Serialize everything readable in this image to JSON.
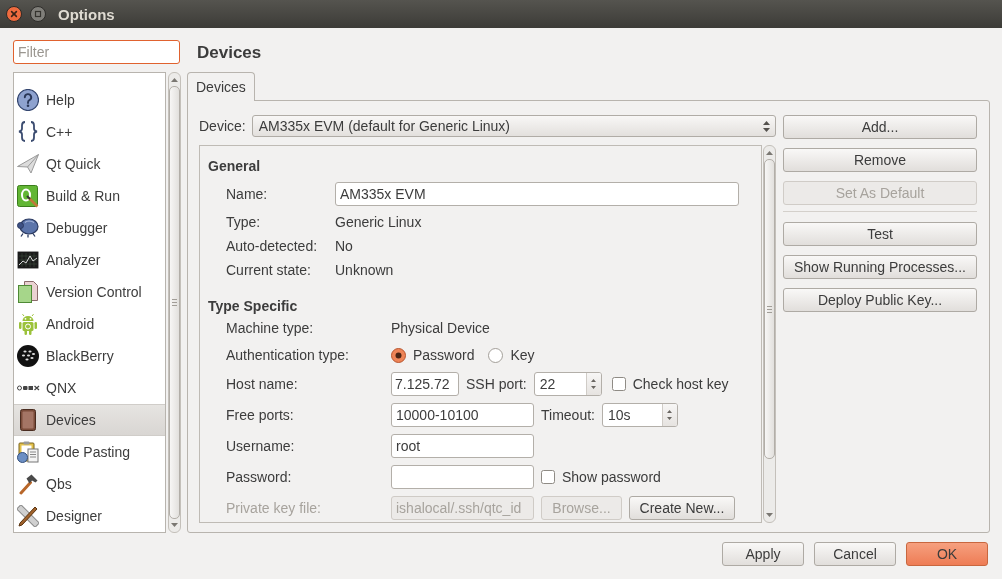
{
  "window": {
    "title": "Options"
  },
  "filter": {
    "placeholder": "Filter",
    "focused": true
  },
  "sidebar": {
    "items": [
      {
        "label": "Help",
        "selected": false
      },
      {
        "label": "C++",
        "selected": false
      },
      {
        "label": "Qt Quick",
        "selected": false
      },
      {
        "label": "Build & Run",
        "selected": false
      },
      {
        "label": "Debugger",
        "selected": false
      },
      {
        "label": "Analyzer",
        "selected": false
      },
      {
        "label": "Version Control",
        "selected": false
      },
      {
        "label": "Android",
        "selected": false
      },
      {
        "label": "BlackBerry",
        "selected": false
      },
      {
        "label": "QNX",
        "selected": false
      },
      {
        "label": "Devices",
        "selected": true
      },
      {
        "label": "Code Pasting",
        "selected": false
      },
      {
        "label": "Qbs",
        "selected": false
      },
      {
        "label": "Designer",
        "selected": false
      }
    ]
  },
  "page": {
    "title": "Devices",
    "tabs": [
      {
        "label": "Devices",
        "selected": true
      }
    ]
  },
  "device_selector": {
    "label": "Device:",
    "value": "AM335x EVM (default for Generic Linux)"
  },
  "general": {
    "title": "General",
    "rows": [
      {
        "label": "Name:",
        "kind": "field",
        "value": "AM335x EVM"
      },
      {
        "label": "Type:",
        "kind": "text",
        "value": "Generic Linux"
      },
      {
        "label": "Auto-detected:",
        "kind": "text",
        "value": "No"
      },
      {
        "label": "Current state:",
        "kind": "text",
        "value": "Unknown"
      }
    ]
  },
  "type_specific": {
    "title": "Type Specific",
    "rows": [
      {
        "label": "Machine type:",
        "disabled": false,
        "items": [
          {
            "kind": "text",
            "value": "Physical Device",
            "disabled": false
          }
        ]
      },
      {
        "label": "Authentication type:",
        "disabled": false,
        "items": [
          {
            "kind": "radio",
            "label": "Password",
            "selected": true,
            "disabled": false
          },
          {
            "kind": "radio",
            "label": "Key",
            "selected": false,
            "disabled": false
          }
        ]
      },
      {
        "label": "Host name:",
        "disabled": false,
        "items": [
          {
            "kind": "field",
            "value": "7.125.72",
            "disabled": false
          },
          {
            "kind": "label",
            "value": "SSH port:",
            "disabled": false
          },
          {
            "kind": "spin",
            "value": "22",
            "disabled": false
          },
          {
            "kind": "checkbox",
            "label": "Check host key",
            "checked": false,
            "disabled": false
          }
        ]
      },
      {
        "label": "Free ports:",
        "disabled": false,
        "items": [
          {
            "kind": "field",
            "value": "10000-10100",
            "disabled": false
          },
          {
            "kind": "label",
            "value": "Timeout:",
            "disabled": false
          },
          {
            "kind": "spin",
            "value": "10s",
            "disabled": false
          }
        ]
      },
      {
        "label": "Username:",
        "disabled": false,
        "items": [
          {
            "kind": "field",
            "value": "root",
            "disabled": false
          }
        ]
      },
      {
        "label": "Password:",
        "disabled": false,
        "items": [
          {
            "kind": "field",
            "disabled": false
          },
          {
            "kind": "checkbox",
            "label": "Show password",
            "checked": false,
            "disabled": false
          }
        ]
      },
      {
        "label": "Private key file:",
        "disabled": true,
        "items": [
          {
            "kind": "field",
            "value": "ishalocal/.ssh/qtc_id",
            "disabled": true
          },
          {
            "kind": "button",
            "label": "Browse...",
            "disabled": true
          },
          {
            "kind": "button",
            "label": "Create New...",
            "disabled": false
          }
        ]
      }
    ]
  },
  "device_actions": [
    {
      "buttons": [
        {
          "label": "Add...",
          "disabled": false
        },
        {
          "label": "Remove",
          "disabled": false
        },
        {
          "label": "Set As Default",
          "disabled": true
        }
      ]
    },
    {
      "buttons": [
        {
          "label": "Test",
          "disabled": false
        },
        {
          "label": "Show Running Processes...",
          "disabled": false
        },
        {
          "label": "Deploy Public Key...",
          "disabled": false
        }
      ]
    }
  ],
  "dialog_buttons": [
    {
      "label": "Apply",
      "default": false
    },
    {
      "label": "Cancel",
      "default": false
    },
    {
      "label": "OK",
      "default": true
    }
  ]
}
